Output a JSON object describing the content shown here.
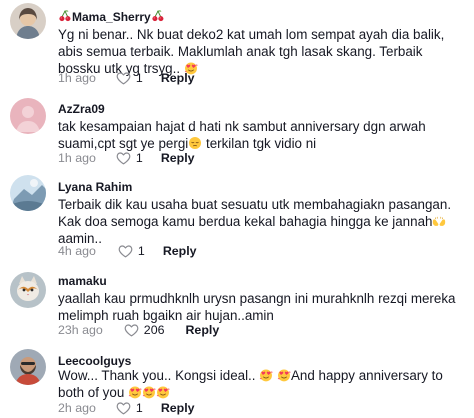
{
  "comments": [
    {
      "username": "Mama_Sherry",
      "username_prefix_icon": "cherries-icon",
      "username_suffix_icon": "cherries-icon",
      "text": "Yg ni benar.. Nk buat deko2 kat umah lom sempat ayah dia balik, abis semua terbaik. Maklumlah anak tgh lasak skang. Terbaik bossku utk yg trsyg..",
      "text_suffix_icon": "heart-face-icon",
      "time": "1h ago",
      "likes": "1",
      "reply_label": "Reply"
    },
    {
      "username": "AzZra09",
      "text": "tak kesampaian hajat d hati nk sambut anniversary dgn arwah suami,cpt sgt ye pergi",
      "text_mid_icon": "pensive-face-icon",
      "text_after_icon": "terkilan tgk vidio ni",
      "time": "1h ago",
      "likes": "1",
      "reply_label": "Reply"
    },
    {
      "username": "Lyana Rahim",
      "text": "Terbaik dik kau usaha buat sesuatu utk membahagiakn pasangan. Kak doa semoga kamu berdua kekal bahagia hingga ke jannah",
      "text_mid_icon": "open-hands-icon",
      "text_after_icon": "aamin..",
      "time": "4h ago",
      "likes": "1",
      "reply_label": "Reply"
    },
    {
      "username": "mamaku",
      "text": "yaallah kau prmudhknlh urysn pasangn ini murahknlh rezqi mereka melimph ruah bgaikn air hujan..amin",
      "time": "23h ago",
      "likes": "206",
      "reply_label": "Reply"
    },
    {
      "username": "Leecoolguys",
      "text_part1": "Wow... Thank you.. Kongsi ideal..",
      "text_part2": "And happy anniversary to both of you",
      "icon_name": "heart-face-icon",
      "time": "2h ago",
      "likes": "1",
      "reply_label": "Reply"
    }
  ],
  "colors": {
    "text": "#161823",
    "meta": "#8a8b91",
    "emoji_face": "#ffc83d",
    "emoji_heart": "#f4385a"
  }
}
